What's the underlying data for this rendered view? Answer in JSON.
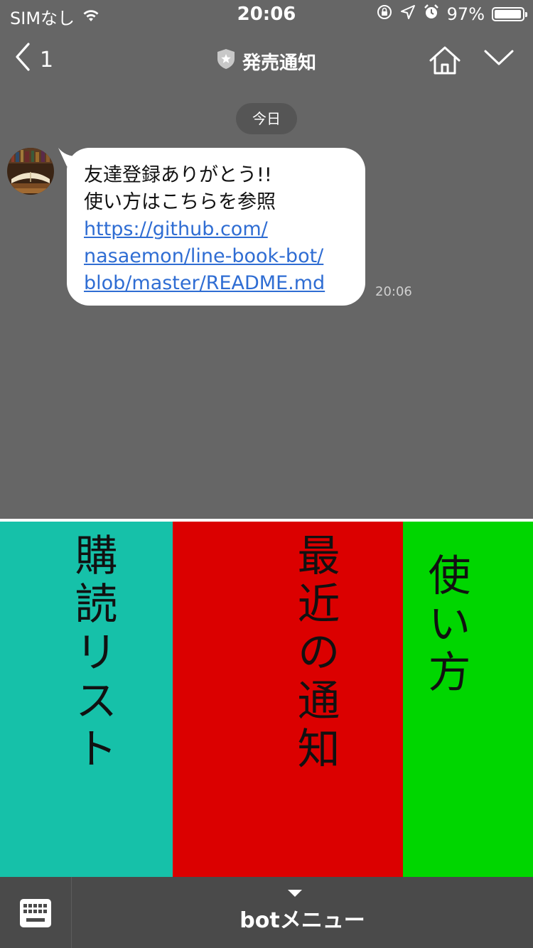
{
  "status_bar": {
    "carrier": "SIMなし",
    "time": "20:06",
    "battery": "97%",
    "battery_level": 0.97,
    "icons": [
      "wifi-icon",
      "rotation-lock-icon",
      "location-icon",
      "alarm-icon",
      "battery-icon"
    ]
  },
  "header": {
    "back_count": "1",
    "title": "発売通知",
    "icons": [
      "back-chevron-icon",
      "official-badge-icon",
      "home-icon",
      "chevron-down-icon"
    ]
  },
  "chat": {
    "date_label": "今日",
    "message": {
      "line1": "友達登録ありがとう!!",
      "line2": "使い方はこちらを参照",
      "link_lines": [
        "https://github.com/",
        "nasaemon/line-book-bot/",
        "blob/master/README.md"
      ],
      "time": "20:06"
    }
  },
  "rich_menu": {
    "items": [
      {
        "label": "購読リスト",
        "color": "#16c1a9"
      },
      {
        "label": "最近の通知",
        "color": "#db0000"
      },
      {
        "label": "使い方",
        "color": "#00d600"
      }
    ]
  },
  "bottom_bar": {
    "menu_label": "botメニュー",
    "icons": [
      "keyboard-icon",
      "caret-down-icon"
    ]
  }
}
